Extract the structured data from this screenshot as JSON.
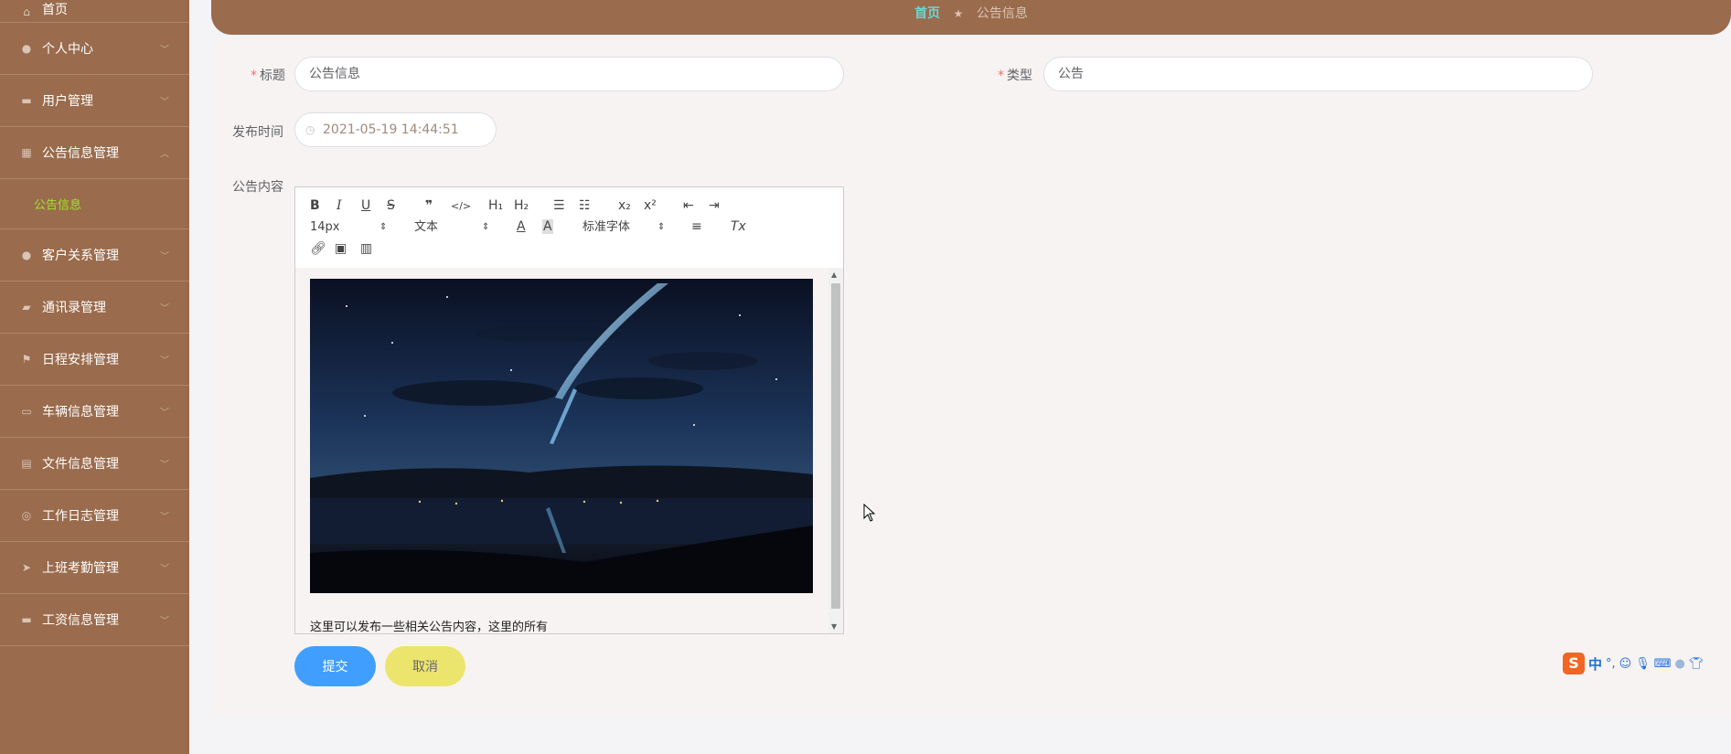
{
  "sidebar": {
    "items": [
      {
        "label": "首页",
        "icon": "home-icon"
      },
      {
        "label": "个人中心",
        "icon": "user-icon"
      },
      {
        "label": "用户管理",
        "icon": "users-manage-icon"
      },
      {
        "label": "公告信息管理",
        "icon": "grid-icon"
      },
      {
        "label": "客户关系管理",
        "icon": "customer-icon"
      },
      {
        "label": "通讯录管理",
        "icon": "briefcase-icon"
      },
      {
        "label": "日程安排管理",
        "icon": "flag-icon"
      },
      {
        "label": "车辆信息管理",
        "icon": "card-icon"
      },
      {
        "label": "文件信息管理",
        "icon": "file-icon"
      },
      {
        "label": "工作日志管理",
        "icon": "compass-icon"
      },
      {
        "label": "上班考勤管理",
        "icon": "send-icon"
      },
      {
        "label": "工资信息管理",
        "icon": "keyboard-icon"
      }
    ],
    "submenu_label": "公告信息"
  },
  "breadcrumb": {
    "home": "首页",
    "separator": "★",
    "current": "公告信息"
  },
  "form": {
    "title_label": "标题",
    "title_value": "公告信息",
    "type_label": "类型",
    "type_value": "公告",
    "time_label": "发布时间",
    "time_value": "2021-05-19 14:44:51",
    "content_label": "公告内容",
    "required_mark": "*"
  },
  "editor": {
    "toolbar": {
      "bold": "B",
      "italic": "I",
      "underline": "U",
      "strike": "S",
      "quote": "❞",
      "code": "</>",
      "h1": "H₁",
      "h2": "H₂",
      "ordered_list": "☰",
      "bullet_list": "☷",
      "subscript": "x₂",
      "superscript": "x²",
      "outdent": "⇤",
      "indent": "⇥",
      "size_select": "14px",
      "header_select": "文本",
      "font_select": "标准字体",
      "color": "A",
      "background": "A",
      "align": "≡",
      "clean": "Tx"
    },
    "content_text": "这里可以发布一些相关公告内容，这里的所有"
  },
  "buttons": {
    "submit": "提交",
    "cancel": "取消"
  },
  "ime": {
    "zh": "中",
    "punct": "°,"
  },
  "colors": {
    "sidebar": "#9a6b4c",
    "accent_green": "#a6e22e",
    "submit": "#409eff",
    "cancel": "#ebe56e"
  }
}
